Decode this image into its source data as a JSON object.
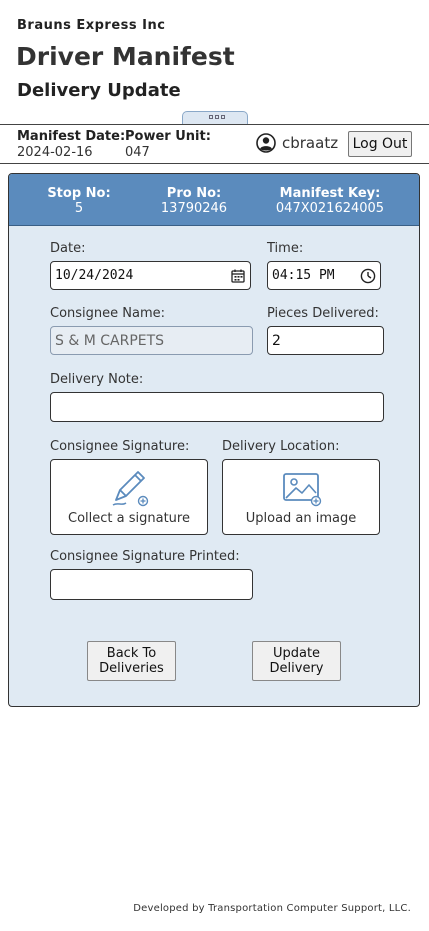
{
  "app": {
    "company": "Brauns Express Inc",
    "title": "Driver Manifest",
    "page_title": "Delivery Update"
  },
  "header": {
    "manifest_date_label": "Manifest Date:",
    "manifest_date": "2024-02-16",
    "power_unit_label": "Power Unit:",
    "power_unit": "047",
    "user_icon": "account-circle-icon",
    "username": "cbraatz",
    "logout_label": "Log Out"
  },
  "stop": {
    "stop_no_label": "Stop No:",
    "stop_no": "5",
    "pro_no_label": "Pro No:",
    "pro_no": "13790246",
    "manifest_key_label": "Manifest Key:",
    "manifest_key": "047X021624005"
  },
  "form": {
    "date_label": "Date:",
    "date_value": "10/24/2024",
    "time_label": "Time:",
    "time_value": "04:15 PM",
    "consignee_label": "Consignee Name:",
    "consignee_value": "S & M CARPETS",
    "pieces_label": "Pieces Delivered:",
    "pieces_value": "2",
    "note_label": "Delivery Note:",
    "note_value": "",
    "signature_label": "Consignee Signature:",
    "signature_button": "Collect a signature",
    "location_label": "Delivery Location:",
    "location_button": "Upload an image",
    "printed_label": "Consignee Signature Printed:",
    "printed_value": ""
  },
  "actions": {
    "back_line1": "Back To",
    "back_line2": "Deliveries",
    "update_line1": "Update",
    "update_line2": "Delivery"
  },
  "colors": {
    "card_header": "#5b8bbd",
    "card_body": "#e0eaf3"
  },
  "footer": {
    "credit": "Developed by Transportation Computer Support, LLC."
  }
}
